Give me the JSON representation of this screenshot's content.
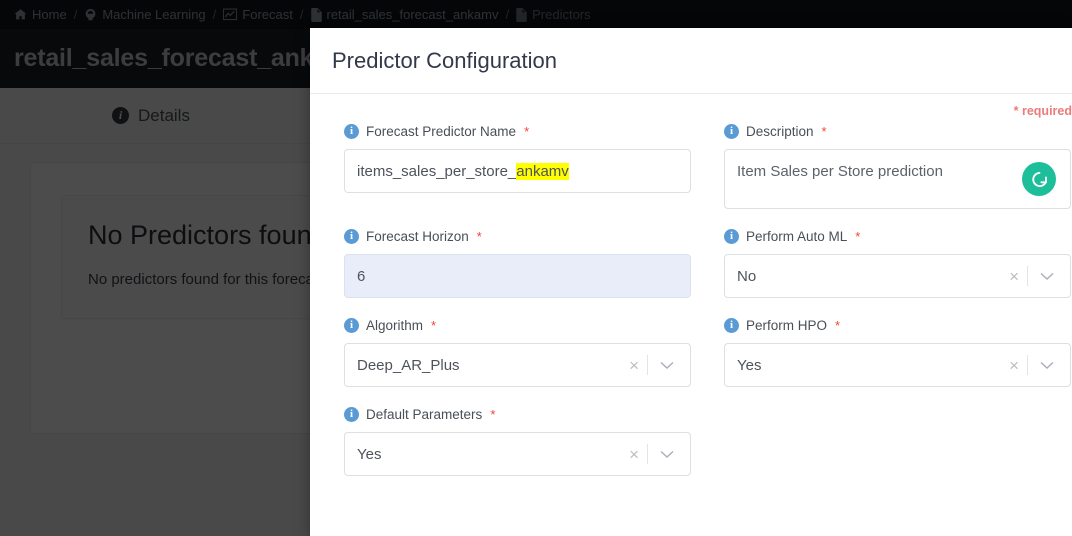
{
  "breadcrumb": {
    "items": [
      {
        "label": "Home",
        "icon": "home-icon"
      },
      {
        "label": "Machine Learning",
        "icon": "ml-bulb-icon"
      },
      {
        "label": "Forecast",
        "icon": "chart-line-icon"
      },
      {
        "label": "retail_sales_forecast_ankamv",
        "icon": "file-icon"
      },
      {
        "label": "Predictors",
        "icon": "file-icon"
      }
    ],
    "separator": "/"
  },
  "page": {
    "title": "retail_sales_forecast_ankamv",
    "tab_details_label": "Details",
    "empty_title": "No Predictors found !!",
    "empty_subtitle": "No predictors found for this forecast ."
  },
  "modal": {
    "title": "Predictor Configuration",
    "required_note": "* required",
    "fields": [
      {
        "id": "forecast-predictor-name",
        "label": "Forecast Predictor Name",
        "required_star": "*",
        "type": "text",
        "value_plain": "items_sales_per_store_",
        "value_highlight": "ankamv",
        "value": "items_sales_per_store_ankamv"
      },
      {
        "id": "description",
        "label": "Description",
        "required_star": "*",
        "type": "textarea",
        "value": "Item Sales per Store prediction",
        "action_icon": "refresh-icon",
        "action_icon_color": "#1dbf9a"
      },
      {
        "id": "forecast-horizon",
        "label": "Forecast Horizon",
        "required_star": "*",
        "type": "text",
        "value": "6",
        "state": "highlighted"
      },
      {
        "id": "perform-auto-ml",
        "label": "Perform Auto ML",
        "required_star": "*",
        "type": "select",
        "value": "No"
      },
      {
        "id": "algorithm",
        "label": "Algorithm",
        "required_star": "*",
        "type": "select",
        "value": "Deep_AR_Plus"
      },
      {
        "id": "perform-hpo",
        "label": "Perform HPO",
        "required_star": "*",
        "type": "select",
        "value": "Yes"
      },
      {
        "id": "default-parameters",
        "label": "Default Parameters",
        "required_star": "*",
        "type": "select",
        "value": "Yes"
      }
    ],
    "select_clear_glyph": "×",
    "info_glyph": "i"
  },
  "colors": {
    "navbar": "#12161c",
    "title_bar": "#1a1f26",
    "accent_blue": "#5b9bd5",
    "required_red": "#f44336",
    "refresh_green": "#1dbf9a",
    "highlight_yellow": "#ffff00",
    "focus_field_bg": "#e8edf9"
  }
}
